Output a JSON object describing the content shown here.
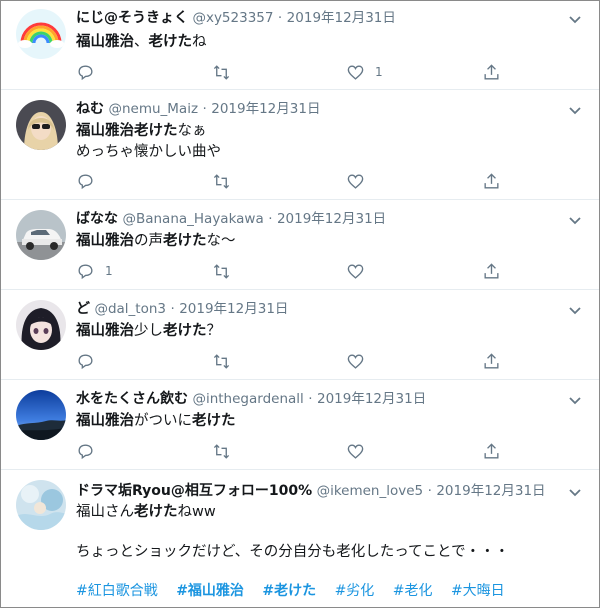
{
  "tweets": [
    {
      "name": "にじ@そうきょく",
      "handle": "@xy523357",
      "date": "2019年12月31日",
      "body": [
        {
          "text": "福山雅治",
          "bold": true
        },
        {
          "text": "、",
          "bold": false
        },
        {
          "text": "老けた",
          "bold": true
        },
        {
          "text": "ね",
          "bold": false
        }
      ],
      "body2": [],
      "avatar": "rainbow-avatar",
      "reply_count": "",
      "retweet_count": "",
      "like_count": "1"
    },
    {
      "name": "ねむ",
      "handle": "@nemu_Maiz",
      "date": "2019年12月31日",
      "body": [
        {
          "text": "福山雅治",
          "bold": true
        },
        {
          "text": "老けた",
          "bold": true
        },
        {
          "text": "なぁ",
          "bold": false
        }
      ],
      "body2": [
        {
          "text": "めっちゃ懐かしい曲や",
          "bold": false
        }
      ],
      "avatar": "character-avatar",
      "reply_count": "",
      "retweet_count": "",
      "like_count": ""
    },
    {
      "name": "ばなな",
      "handle": "@Banana_Hayakawa",
      "date": "2019年12月31日",
      "body": [
        {
          "text": "福山雅治",
          "bold": true
        },
        {
          "text": "の声",
          "bold": false
        },
        {
          "text": "老けた",
          "bold": true
        },
        {
          "text": "な～",
          "bold": false
        }
      ],
      "body2": [],
      "avatar": "car-avatar",
      "reply_count": "1",
      "retweet_count": "",
      "like_count": ""
    },
    {
      "name": "ど",
      "handle": "@dal_ton3",
      "date": "2019年12月31日",
      "body": [
        {
          "text": "福山雅治",
          "bold": true
        },
        {
          "text": "少し",
          "bold": false
        },
        {
          "text": "老けた",
          "bold": true
        },
        {
          "text": "？",
          "bold": false
        }
      ],
      "body2": [],
      "avatar": "anime-avatar",
      "reply_count": "",
      "retweet_count": "",
      "like_count": ""
    },
    {
      "name": "水をたくさん飲む",
      "handle": "@inthegardenall",
      "date": "2019年12月31日",
      "body": [
        {
          "text": "福山雅治",
          "bold": true
        },
        {
          "text": "がついに",
          "bold": false
        },
        {
          "text": "老けた",
          "bold": true
        }
      ],
      "body2": [],
      "avatar": "sky-avatar",
      "reply_count": "",
      "retweet_count": "",
      "like_count": ""
    },
    {
      "name": "ドラマ垢Ryou@相互フォロー100%",
      "handle": "@ikemen_love5",
      "date": "2019年12月31日",
      "body": [
        {
          "text": "福山さん",
          "bold": false
        },
        {
          "text": "老けた",
          "bold": true
        },
        {
          "text": "ねww",
          "bold": false
        }
      ],
      "body2": [
        {
          "text": "ちょっとショックだけど、その分自分も老化したってことで・・・",
          "bold": false
        }
      ],
      "avatar": "photo-avatar",
      "hashtags": [
        {
          "text": "#紅白歌合戦",
          "bold": false
        },
        {
          "text": "#福山雅治",
          "bold": true
        },
        {
          "text": "#老けた",
          "bold": true
        },
        {
          "text": "#劣化",
          "bold": false
        },
        {
          "text": "#老化",
          "bold": false
        },
        {
          "text": "#大晦日",
          "bold": false
        }
      ]
    }
  ],
  "separator": "·",
  "icons": {
    "reply": "reply-icon",
    "retweet": "retweet-icon",
    "like": "like-icon",
    "share": "share-icon",
    "caret": "chevron-down-icon"
  },
  "colors": {
    "text": "#14171a",
    "muted": "#657786",
    "link": "#1b95e0",
    "border": "#e6ecf0"
  }
}
